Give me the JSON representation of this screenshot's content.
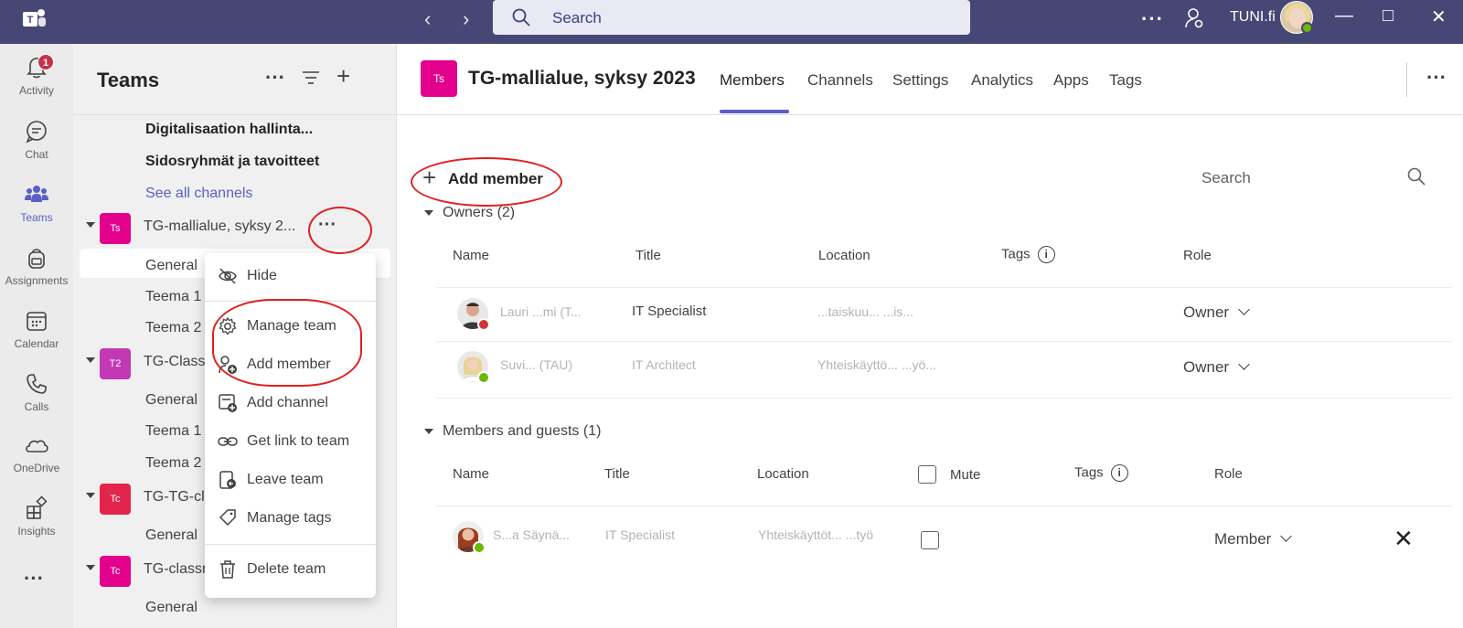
{
  "titlebar": {
    "search_placeholder": "Search",
    "tenant": "TUNI.fi",
    "more": "···"
  },
  "rail": {
    "items": [
      {
        "label": "Activity",
        "badge": "1"
      },
      {
        "label": "Chat"
      },
      {
        "label": "Teams"
      },
      {
        "label": "Assignments"
      },
      {
        "label": "Calendar"
      },
      {
        "label": "Calls"
      },
      {
        "label": "OneDrive"
      },
      {
        "label": "Insights"
      }
    ],
    "more": "···"
  },
  "pane": {
    "title": "Teams",
    "channels_above": [
      "Digitalisaation hallinta...",
      "Sidosryhmät ja tavoitteet"
    ],
    "see_all": "See all channels",
    "teams": [
      {
        "abbr": "Ts",
        "name": "TG-mallialue, syksy 2...",
        "color": "#e3008c",
        "channels": [
          "General",
          "Teema 1",
          "Teema 2"
        ]
      },
      {
        "abbr": "T2",
        "name": "TG-Class",
        "color": "#c239b3",
        "channels": [
          "General",
          "Teema 1",
          "Teema 2"
        ]
      },
      {
        "abbr": "Tc",
        "name": "TG-TG-cl",
        "color": "#e3244b",
        "channels": [
          "General"
        ]
      },
      {
        "abbr": "Tc",
        "name": "TG-classr",
        "color": "#e3008c",
        "channels": [
          "General"
        ]
      }
    ],
    "team_more": "···"
  },
  "context_menu": {
    "items": [
      "Hide",
      "Manage team",
      "Add member",
      "Add channel",
      "Get link to team",
      "Leave team",
      "Manage tags",
      "Delete team"
    ]
  },
  "main": {
    "avatar": "Ts",
    "title": "TG-mallialue, syksy 2023",
    "tabs": [
      "Members",
      "Channels",
      "Settings",
      "Analytics",
      "Apps",
      "Tags"
    ],
    "add_member": "Add member",
    "search_placeholder": "Search",
    "owners_section": "Owners (2)",
    "owners_columns": [
      "Name",
      "Title",
      "Location",
      "Tags",
      "Role"
    ],
    "owners": [
      {
        "name": "Lauri ...mi (T...",
        "title": "IT Specialist",
        "location": "...taiskuu...     ...is...",
        "role": "Owner"
      },
      {
        "name": "Suvi...     (TAU)",
        "title": "IT Architect",
        "location": "Yhteiskäyttö...   ...yö...",
        "role": "Owner"
      }
    ],
    "members_section": "Members and guests (1)",
    "members_columns": [
      "Name",
      "Title",
      "Location",
      "Mute",
      "Tags",
      "Role"
    ],
    "members": [
      {
        "name": "S...a Säynä...",
        "title": "IT Specialist",
        "location": "Yhteiskäyttöt...   ...työ",
        "role": "Member"
      }
    ]
  },
  "colors": {
    "titlebar": "#464775",
    "accent": "#5b5fc7",
    "annotation": "#e02020"
  }
}
